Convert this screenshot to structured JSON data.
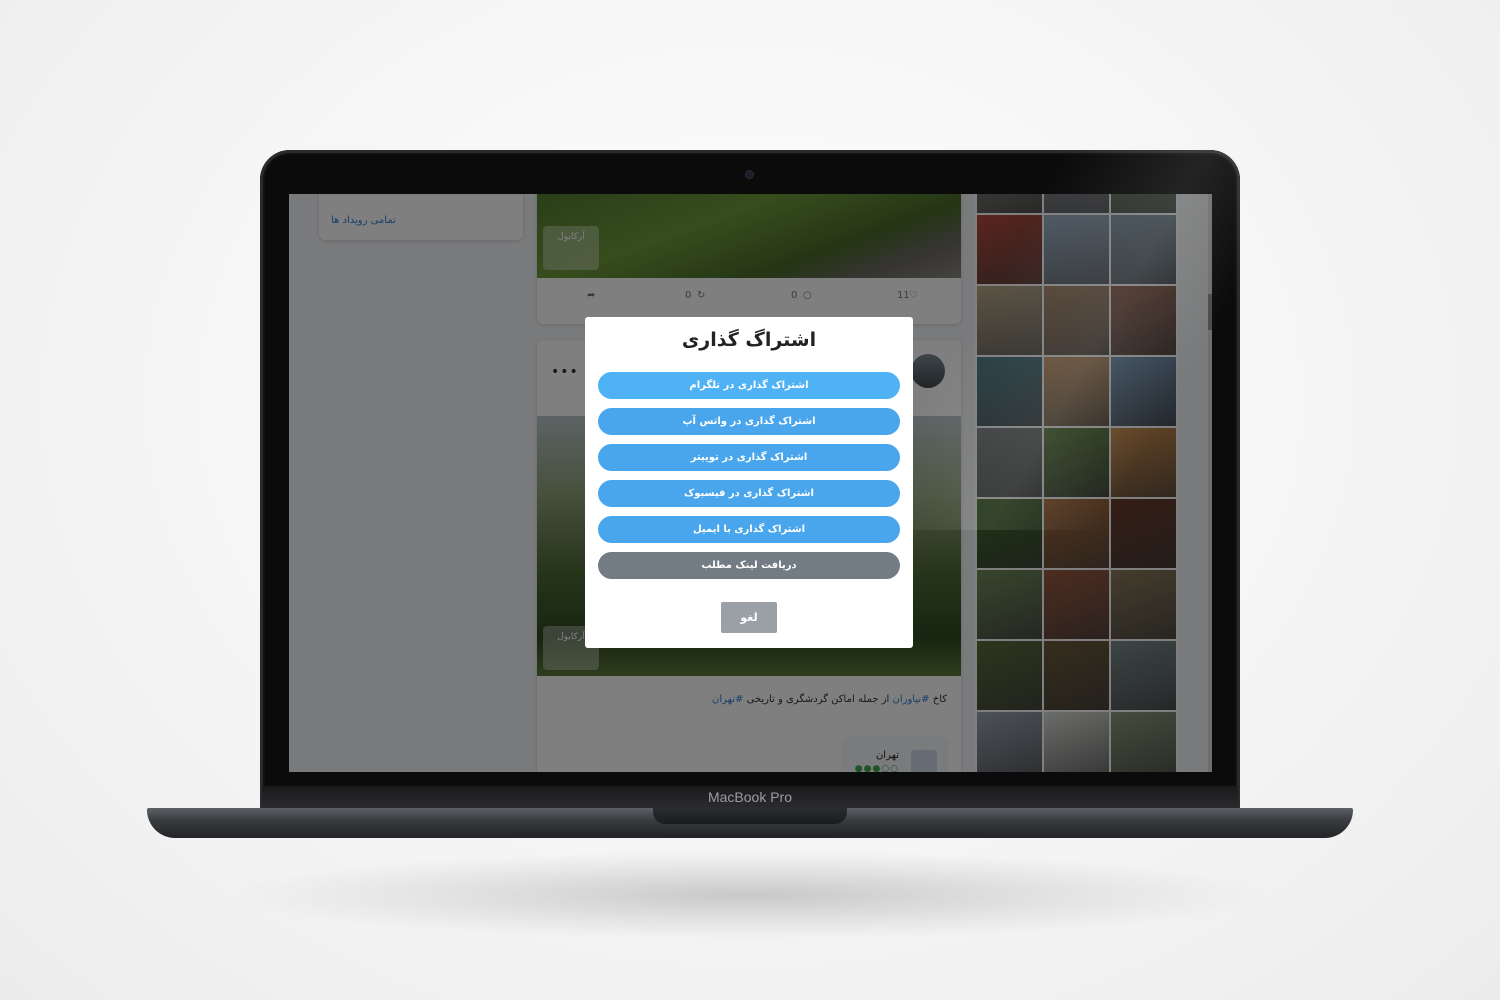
{
  "device": {
    "brand_label": "MacBook Pro"
  },
  "sidebar": {
    "all_events_link": "تمامی رویداد ها"
  },
  "feed": {
    "post1": {
      "watermark": "آرکایول",
      "actions": {
        "likes": "11",
        "comments": "0",
        "reposts": "0"
      }
    },
    "post2": {
      "watermark": "آرکایول",
      "caption_prefix": "کاخ",
      "caption_tag1": "#نیاوران",
      "caption_middle": "از جمله اماکن گردشگری و تاریخی",
      "caption_tag2": "#تهران",
      "place": {
        "name": "تهران",
        "rating_dots": "●●●○○"
      }
    }
  },
  "gallery": {
    "tile_colors": [
      "#8c8f86",
      "#9a9fa8",
      "#6f8a6a",
      "#b54b3d",
      "#9db3c9",
      "#7f97a8",
      "#b9a98a",
      "#a7876a",
      "#8a5a48",
      "#4f7e8a",
      "#c79a6a",
      "#6f8fb0",
      "#7a7f80",
      "#567a3a",
      "#c98a4a",
      "#3f6a2a",
      "#a86b3a",
      "#6a3a2a",
      "#6f8a5a",
      "#9a5a42",
      "#8a7a5a",
      "#5a6a3a",
      "#6b5a3a",
      "#7a8a8a",
      "#9aa4b0",
      "#d8dcd6",
      "#8a9a7a"
    ]
  },
  "modal": {
    "title": "اشتراگ گذاری",
    "buttons": [
      "اشتراک گذاری در تلگرام",
      "اشتراک گذاری در واتس آپ",
      "اشتراک گذاری در توییتر",
      "اشتراک گذاری در فیسبوک",
      "اشتراک گذاری با ایمیل"
    ],
    "link_button": "دریافت لینک مطلب",
    "cancel_button": "لغو"
  },
  "colors": {
    "share_button": "#4aa6ec",
    "link_button": "#737b85",
    "cancel_button": "#9aa0a6",
    "link_text": "#2d7fd6"
  }
}
